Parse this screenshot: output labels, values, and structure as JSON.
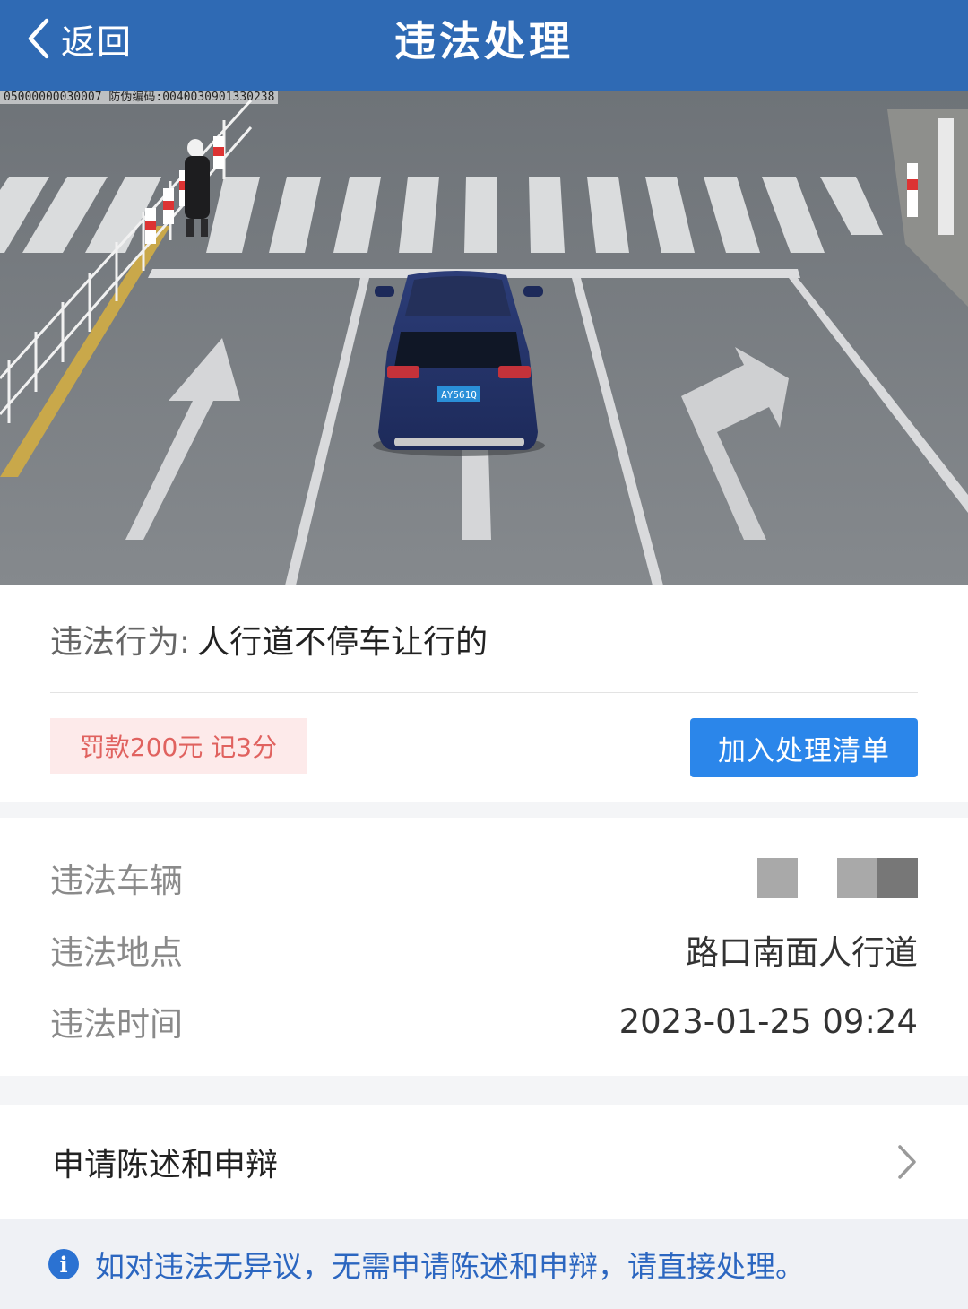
{
  "header": {
    "back_label": "返回",
    "title": "违法处理"
  },
  "photo": {
    "watermark": "05000000030007 防伪编码:0040030901330238",
    "plate_text": "AY561Q"
  },
  "violation": {
    "behavior_label": "违法行为:",
    "behavior_value": "人行道不停车让行的",
    "penalty": "罚款200元 记3分",
    "add_button": "加入处理清单"
  },
  "details": {
    "vehicle_label": "违法车辆",
    "location_label": "违法地点",
    "location_value": "路口南面人行道",
    "time_label": "违法时间",
    "time_value": "2023-01-25 09:24"
  },
  "appeal": {
    "label": "申请陈述和申辩"
  },
  "notice": {
    "icon": "info-icon",
    "text": "如对违法无异议，无需申请陈述和申辩，请直接处理。"
  },
  "colors": {
    "header_bg": "#2f6ab4",
    "button_bg": "#2b86ea",
    "penalty_text": "#e0625f",
    "penalty_bg": "#fdeaea",
    "notice_text": "#2b66c0"
  }
}
